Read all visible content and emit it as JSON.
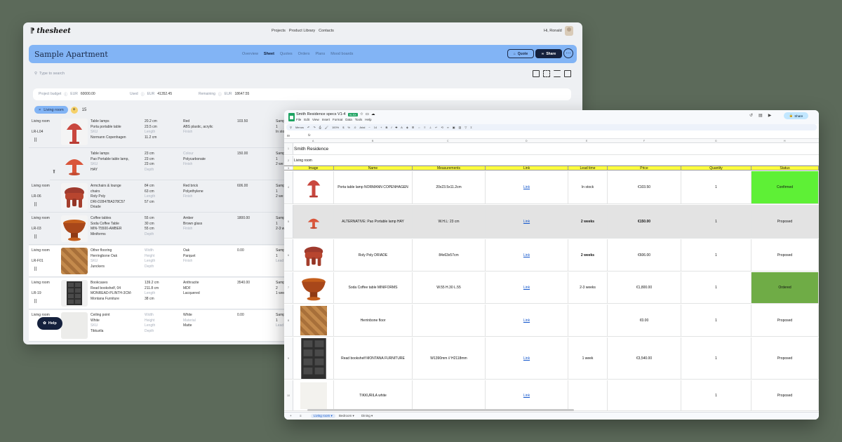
{
  "app": {
    "logo": "thesheet",
    "nav": [
      "Projects",
      "Product Library",
      "Contacts"
    ],
    "greeting": "Hi, Ronald"
  },
  "project": {
    "title": "Sample Apartment",
    "tabs": [
      "Overview",
      "Sheet",
      "Quotes",
      "Orders",
      "Plans",
      "Mood boards"
    ],
    "active_tab": "Sheet",
    "quote_label": "Quote",
    "share_label": "Share"
  },
  "search": {
    "placeholder": "Type to search"
  },
  "budget": {
    "project_label": "Project budget",
    "project_cur": "EUR",
    "project_value": "60000.00",
    "used_label": "Used",
    "used_cur": "EUR",
    "used_value": "41352.45",
    "remaining_label": "Remaining",
    "remaining_cur": "EUR",
    "remaining_value": "18647.55"
  },
  "room": {
    "name": "Living room",
    "count": "15"
  },
  "items": [
    {
      "room": "Living room",
      "code": "LR-L04",
      "desc": [
        "Table lamps",
        "Porta portable table",
        "SKU",
        "Normann Copenhagen"
      ],
      "meas": [
        "20.2 cm",
        "23.5 cm",
        "Length",
        "11.2 cm"
      ],
      "mat": [
        "Red",
        "ABS plastic, acrylic",
        "Finish"
      ],
      "price": "103.50",
      "stat": [
        "Samp",
        "1",
        "In sto"
      ]
    },
    {
      "room": "",
      "code": "",
      "desc": [
        "Table lamps",
        "Pao Portable table lamp,",
        "SKU",
        "HAY"
      ],
      "meas": [
        "23 cm",
        "23 cm",
        "23 cm",
        "Depth"
      ],
      "mat": [
        "Colour",
        "Polycarbonate",
        "Finish"
      ],
      "price": "150.00",
      "stat": [
        "Samp",
        "1",
        "2 we"
      ]
    },
    {
      "room": "Living room",
      "code": "LR-06",
      "desc": [
        "Armchairs & lounge",
        "chairs",
        "Roly Poly",
        "DRI-D2847BA378C57",
        "Driade"
      ],
      "meas": [
        "84 cm",
        "63 cm",
        "Length",
        "57 cm"
      ],
      "mat": [
        "Red brick",
        "Polyethylene",
        "Finish"
      ],
      "price": "606.00",
      "stat": [
        "Samp",
        "1",
        "2 we"
      ]
    },
    {
      "room": "Living room",
      "code": "LR-03",
      "desc": [
        "Coffee tables",
        "Soda Coffee Table",
        "MIN-T5500-AMBER",
        "Miniforms"
      ],
      "meas": [
        "55 cm",
        "30 cm",
        "55 cm",
        "Depth"
      ],
      "mat": [
        "Amber",
        "Brown glass",
        "Finish"
      ],
      "price": "1800.00",
      "stat": [
        "Samp",
        "1",
        "2-3 w"
      ]
    },
    {
      "room": "Living room",
      "code": "LR-F01",
      "desc": [
        "Other flooring",
        "Herringbone Oak",
        "SKU",
        "Junckers"
      ],
      "meas": [
        "Width",
        "Height",
        "Length",
        "Depth"
      ],
      "mat": [
        "Oak",
        "Parquet",
        "Finish"
      ],
      "price": "0.00",
      "stat": [
        "Samp",
        "1",
        "Lead"
      ]
    },
    {
      "room": "Living room",
      "code": "LR-19",
      "desc": [
        "Bookcases",
        "Read bookshelf, 04",
        "MONREAD-PLINTH-3CM-",
        "Montana Furniture"
      ],
      "meas": [
        "139.2 cm",
        "211.8 cm",
        "Length",
        "38 cm"
      ],
      "mat": [
        "Anthracite",
        "MDF",
        "Lacquered"
      ],
      "price": "3540.00",
      "stat": [
        "Samp",
        "2",
        "1 wee"
      ]
    },
    {
      "room": "Living room",
      "code": "",
      "desc": [
        "Ceiling point",
        "White",
        "SKU",
        "Tikkurila"
      ],
      "meas": [
        "Width",
        "Height",
        "Length",
        "Depth"
      ],
      "mat": [
        "White",
        "Material",
        "Matte"
      ],
      "price": "0.00",
      "stat": [
        "Samp",
        "1",
        "Lead"
      ]
    }
  ],
  "help_label": "Help",
  "sheet": {
    "doc_title": "Smith Residence specs V1-4",
    "badge": "XLSX",
    "menus": [
      "File",
      "Edit",
      "View",
      "Insert",
      "Format",
      "Data",
      "Tools",
      "Help"
    ],
    "share": "Share",
    "cell_ref": "I9",
    "zoom": "100%",
    "font": "Arial",
    "font_size": "14",
    "menus_label": "Menus",
    "col_letters": [
      "A",
      "B",
      "C",
      "D",
      "E",
      "F",
      "G",
      "H"
    ],
    "title": "Smith Residence",
    "section": "Living room",
    "headers": [
      "Image",
      "Name",
      "Measurements",
      "Link",
      "Lead time",
      "Price",
      "Quantity",
      "Status"
    ],
    "rows": [
      {
        "name": "Porta table lamp NORMANN COPENHAGEN",
        "meas": "20x23.5x11.2cm",
        "link": "Link",
        "lead": "In stock",
        "price": "€103.50",
        "qty": "1",
        "status": "Confirmed"
      },
      {
        "name": "ALTERNATIVE: Pao Portable lamp HAY",
        "meas": "W.H.L: 23 cm",
        "link": "Link",
        "lead": "2 weeks",
        "price": "€150.00",
        "qty": "1",
        "status": "Proposed"
      },
      {
        "name": "Roly Poly DRIADE",
        "meas": "84x63x57cm",
        "link": "Link",
        "lead": "2 weeks",
        "price": "€606.00",
        "qty": "1",
        "status": "Proposed"
      },
      {
        "name": "Soda Coffee table MINIFORMS",
        "meas": "W.55 H.30 L.55",
        "link": "Link",
        "lead": "2-3 weeks",
        "price": "€1,800.00",
        "qty": "1",
        "status": "Ordered"
      },
      {
        "name": "Herrinbone floor",
        "meas": "",
        "link": "Link",
        "lead": "",
        "price": "€0.00",
        "qty": "1",
        "status": "Proposed"
      },
      {
        "name": "Read bookshelf MONTANA FURNITURE",
        "meas": "W1390mm // H2118mm",
        "link": "Link",
        "lead": "1 week",
        "price": "€3,540.00",
        "qty": "1",
        "status": "Proposed"
      },
      {
        "name": "TIKKURILA white",
        "meas": "",
        "link": "Link",
        "lead": "",
        "price": "",
        "qty": "1",
        "status": "Proposed"
      }
    ],
    "tabs": [
      "Living room",
      "Bedroom",
      "Dining"
    ]
  }
}
